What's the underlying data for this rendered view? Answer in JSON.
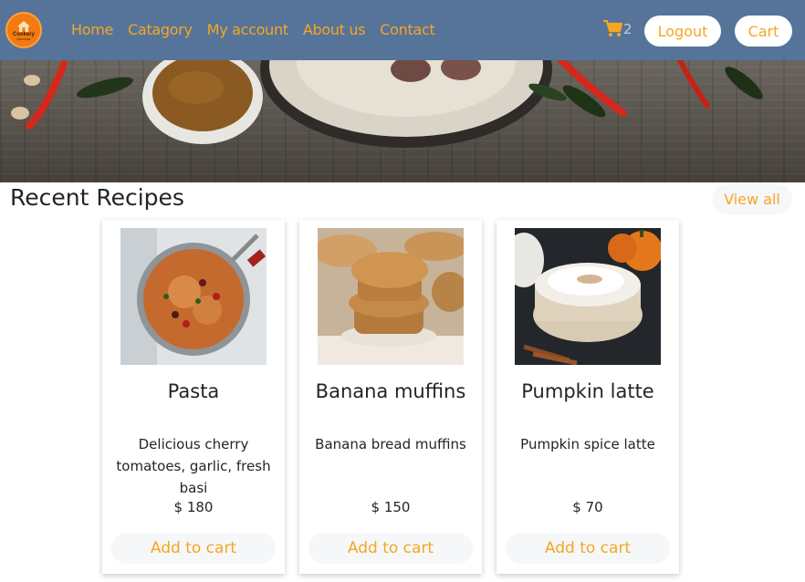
{
  "navbar": {
    "logo_text": "Cookery",
    "logo_subtext": "PARADISE",
    "links": [
      {
        "label": "Home"
      },
      {
        "label": "Catagory"
      },
      {
        "label": "My account"
      },
      {
        "label": "About us"
      },
      {
        "label": "Contact"
      }
    ],
    "cart_count": "2",
    "logout_label": "Logout",
    "cart_label": "Cart"
  },
  "section": {
    "title": "Recent Recipes",
    "view_all_label": "View all"
  },
  "recipes": [
    {
      "title": "Pasta",
      "description": "Delicious cherry tomatoes, garlic, fresh basi",
      "price": "$ 180",
      "button_label": "Add to cart"
    },
    {
      "title": "Banana muffins",
      "description": "Banana bread muffins",
      "price": "$ 150",
      "button_label": "Add to cart"
    },
    {
      "title": "Pumpkin latte",
      "description": "Pumpkin spice latte",
      "price": "$ 70",
      "button_label": "Add to cart"
    }
  ],
  "colors": {
    "navbar_bg": "#567499",
    "accent": "#f5a623",
    "text": "#212529"
  }
}
